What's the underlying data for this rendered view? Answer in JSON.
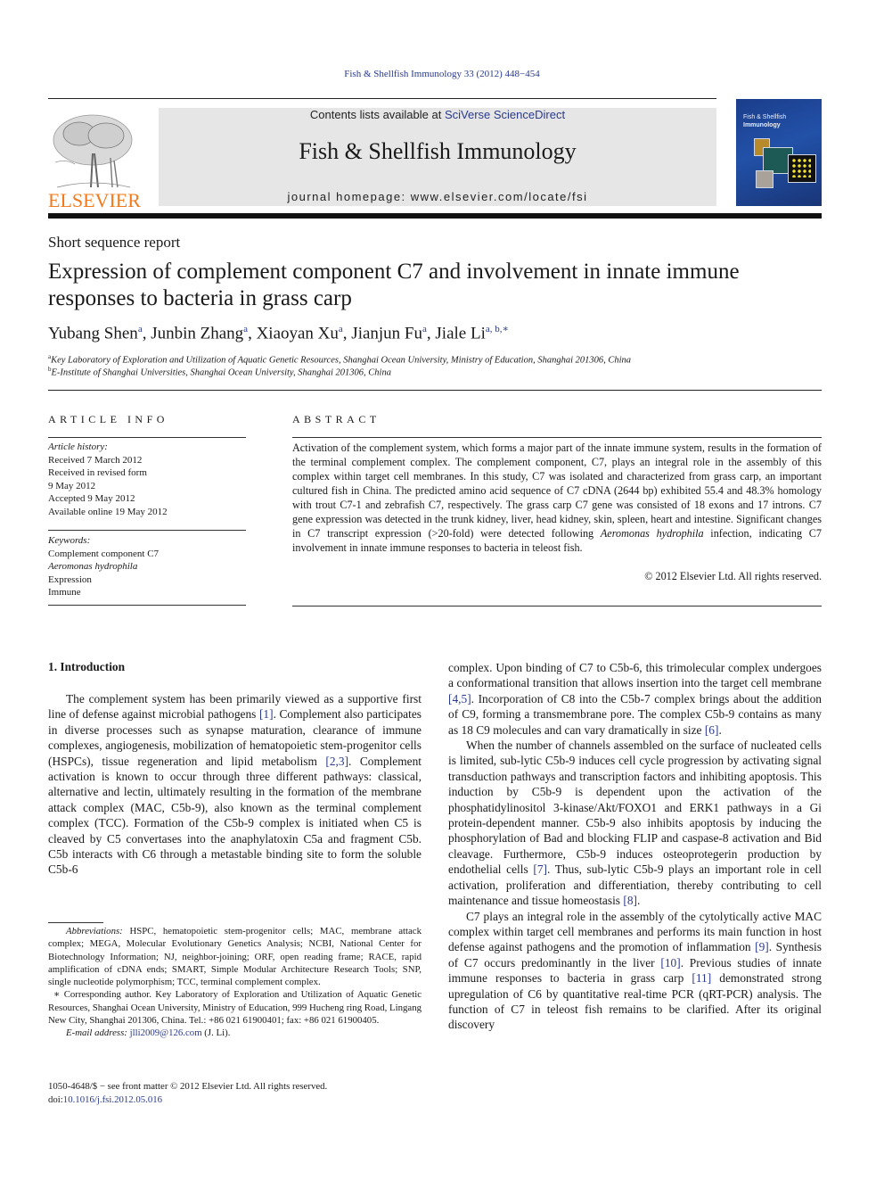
{
  "running_head": "Fish & Shellfish Immunology 33 (2012) 448−454",
  "publisher": {
    "logo_word": "ELSEVIER",
    "brand_color": "#f07a1c"
  },
  "masthead": {
    "contents_prefix": "Contents lists available at ",
    "contents_link": "SciVerse ScienceDirect",
    "journal_title": "Fish & Shellfish Immunology",
    "homepage": "journal homepage: www.elsevier.com/locate/fsi"
  },
  "cover": {
    "line1": "Fish & Shellfish",
    "line2": "Immunology"
  },
  "article": {
    "type": "Short sequence report",
    "title": "Expression of complement component C7 and involvement in innate immune responses to bacteria in grass carp",
    "authors": [
      {
        "name": "Yubang Shen",
        "sup": "a"
      },
      {
        "name": "Junbin Zhang",
        "sup": "a"
      },
      {
        "name": "Xiaoyan Xu",
        "sup": "a"
      },
      {
        "name": "Jianjun Fu",
        "sup": "a"
      },
      {
        "name": "Jiale Li",
        "sup": "a, b,∗"
      }
    ],
    "affiliations": [
      {
        "mark": "a",
        "text": "Key Laboratory of Exploration and Utilization of Aquatic Genetic Resources, Shanghai Ocean University, Ministry of Education, Shanghai 201306, China"
      },
      {
        "mark": "b",
        "text": "E-Institute of Shanghai Universities, Shanghai Ocean University, Shanghai 201306, China"
      }
    ]
  },
  "article_info": {
    "heading": "ARTICLE INFO",
    "history_label": "Article history:",
    "history": [
      "Received 7 March 2012",
      "Received in revised form",
      "9 May 2012",
      "Accepted 9 May 2012",
      "Available online 19 May 2012"
    ],
    "keywords_label": "Keywords:",
    "keywords": [
      {
        "text": "Complement component C7",
        "italic": false
      },
      {
        "text": "Aeromonas hydrophila",
        "italic": true
      },
      {
        "text": "Expression",
        "italic": false
      },
      {
        "text": "Immune",
        "italic": false
      }
    ]
  },
  "abstract": {
    "heading": "ABSTRACT",
    "text_before_italic": "Activation of the complement system, which forms a major part of the innate immune system, results in the formation of the terminal complement complex. The complement component, C7, plays an integral role in the assembly of this complex within target cell membranes. In this study, C7 was isolated and characterized from grass carp, an important cultured fish in China. The predicted amino acid sequence of C7 cDNA (2644 bp) exhibited 55.4 and 48.3% homology with trout C7-1 and zebrafish C7, respectively. The grass carp C7 gene was consisted of 18 exons and 17 introns. C7 gene expression was detected in the trunk kidney, liver, head kidney, skin, spleen, heart and intestine. Significant changes in C7 transcript expression (>20-fold) were detected following ",
    "italic": "Aeromonas hydrophila",
    "text_after_italic": " infection, indicating C7 involvement in innate immune responses to bacteria in teleost fish.",
    "copyright": "© 2012 Elsevier Ltd. All rights reserved."
  },
  "introduction": {
    "heading": "1.  Introduction",
    "left_paragraph": [
      {
        "t": "The complement system has been primarily viewed as a supportive first line of defense against microbial pathogens "
      },
      {
        "ref": "[1]"
      },
      {
        "t": ". Complement also participates in diverse processes such as synapse maturation, clearance of immune complexes, angiogenesis, mobilization of hematopoietic stem-progenitor cells (HSPCs), tissue regeneration and lipid metabolism "
      },
      {
        "ref": "[2,3]"
      },
      {
        "t": ". Complement activation is known to occur through three different pathways: classical, alternative and lectin, ultimately resulting in the formation of the membrane attack complex (MAC, C5b-9), also known as the terminal complement complex (TCC). Formation of the C5b-9 complex is initiated when C5 is cleaved by C5 convertases into the anaphylatoxin C5a and fragment C5b. C5b interacts with C6 through a metastable binding site to form the soluble C5b-6"
      }
    ],
    "right_paragraphs": [
      [
        {
          "t": "complex. Upon binding of C7 to C5b-6, this trimolecular complex undergoes a conformational transition that allows insertion into the target cell membrane "
        },
        {
          "ref": "[4,5]"
        },
        {
          "t": ". Incorporation of C8 into the C5b-7 complex brings about the addition of C9, forming a transmembrane pore. The complex C5b-9 contains as many as 18 C9 molecules and can vary dramatically in size "
        },
        {
          "ref": "[6]"
        },
        {
          "t": "."
        }
      ],
      [
        {
          "t": "When the number of channels assembled on the surface of nucleated cells is limited, sub-lytic C5b-9 induces cell cycle progression by activating signal transduction pathways and transcription factors and inhibiting apoptosis. This induction by C5b-9 is dependent upon the activation of the phosphatidylinositol 3-kinase/Akt/FOXO1 and ERK1 pathways in a Gi protein-dependent manner. C5b-9 also inhibits apoptosis by inducing the phosphorylation of Bad and blocking FLIP and caspase-8 activation and Bid cleavage. Furthermore, C5b-9 induces osteoprotegerin production by endothelial cells "
        },
        {
          "ref": "[7]"
        },
        {
          "t": ". Thus, sub-lytic C5b-9 plays an important role in cell activation, proliferation and differentiation, thereby contributing to cell maintenance and tissue homeostasis "
        },
        {
          "ref": "[8]"
        },
        {
          "t": "."
        }
      ],
      [
        {
          "t": "C7 plays an integral role in the assembly of the cytolytically active MAC complex within target cell membranes and performs its main function in host defense against pathogens and the promotion of inflammation "
        },
        {
          "ref": "[9]"
        },
        {
          "t": ". Synthesis of C7 occurs predominantly in the liver "
        },
        {
          "ref": "[10]"
        },
        {
          "t": ". Previous studies of innate immune responses to bacteria in grass carp "
        },
        {
          "ref": "[11]"
        },
        {
          "t": " demonstrated strong upregulation of C6 by quantitative real-time PCR (qRT-PCR) analysis. The function of C7 in teleost fish remains to be clarified. After its original discovery"
        }
      ]
    ]
  },
  "footnotes": {
    "abbrev_label": "Abbreviations:",
    "abbrev_text": " HSPC, hematopoietic stem-progenitor cells; MAC, membrane attack complex; MEGA, Molecular Evolutionary Genetics Analysis; NCBI, National Center for Biotechnology Information; NJ, neighbor-joining; ORF, open reading frame; RACE, rapid amplification of cDNA ends; SMART, Simple Modular Architecture Research Tools; SNP, single nucleotide polymorphism; TCC, terminal complement complex.",
    "corresponding": "∗ Corresponding author. Key Laboratory of Exploration and Utilization of Aquatic Genetic Resources, Shanghai Ocean University, Ministry of Education, 999 Hucheng ring Road, Lingang New City, Shanghai 201306, China. Tel.: +86 021 61900401; fax: +86 021 61900405.",
    "email_label": "E-mail address:",
    "email": "jlli2009@126.com",
    "email_suffix": " (J. Li)."
  },
  "bottom": {
    "issn_line": "1050-4648/$ − see front matter © 2012 Elsevier Ltd. All rights reserved.",
    "doi_prefix": "doi:",
    "doi": "10.1016/j.fsi.2012.05.016"
  },
  "colors": {
    "link": "#2a3a8c",
    "masthead_bg": "#e6e6e6"
  }
}
